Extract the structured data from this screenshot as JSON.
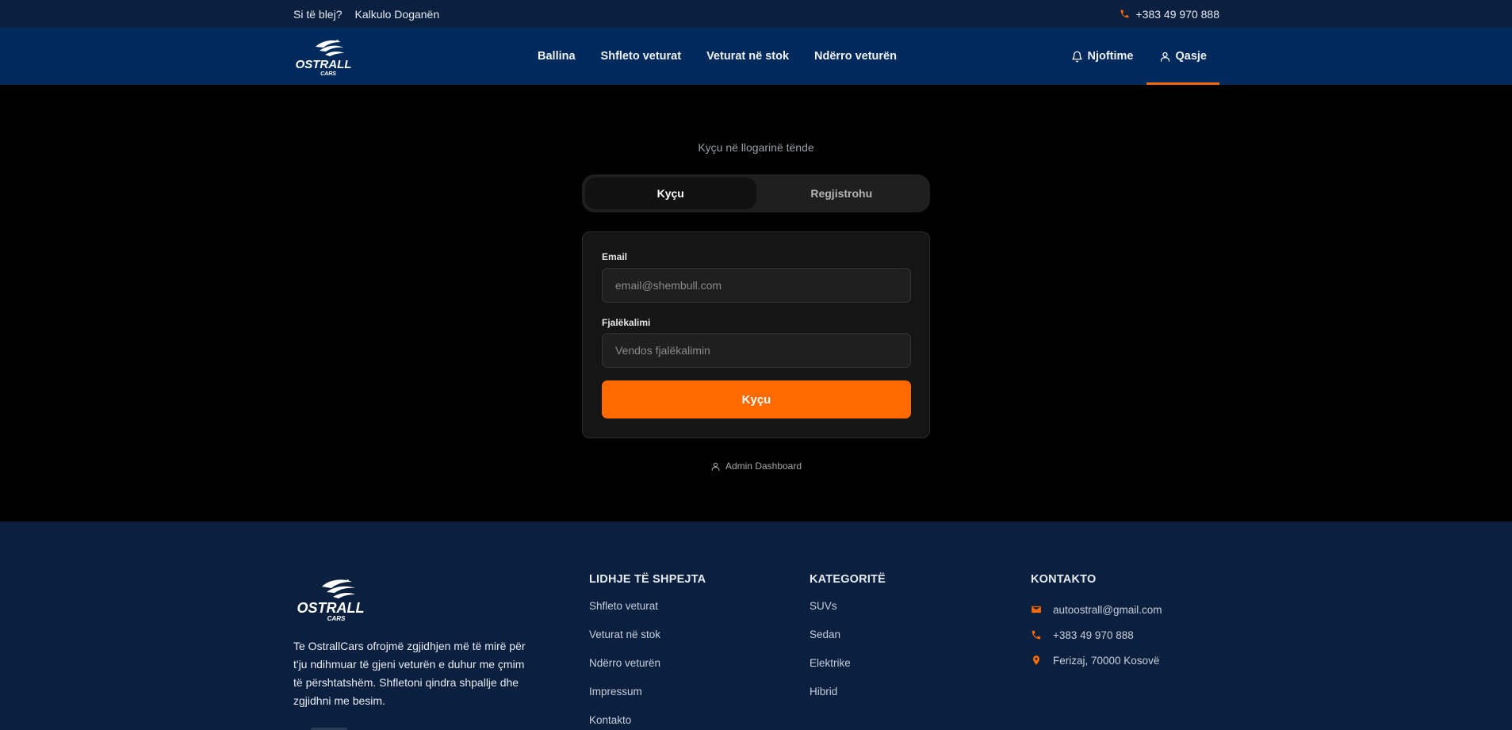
{
  "topbar": {
    "links": [
      "Si të blej?",
      "Kalkulo Doganën"
    ],
    "phone": "+383 49 970 888"
  },
  "brand": {
    "name": "OSTRALL",
    "sub": "CARS"
  },
  "nav": {
    "items": [
      "Ballina",
      "Shfleto veturat",
      "Veturat në stok",
      "Ndërro veturën"
    ],
    "notifications": "Njoftime",
    "access": "Qasje"
  },
  "auth": {
    "subtitle": "Kyçu në llogarinë tënde",
    "tabs": [
      "Kyçu",
      "Regjistrohu"
    ],
    "email_label": "Email",
    "email_placeholder": "email@shembull.com",
    "password_label": "Fjalëkalimi",
    "password_placeholder": "Vendos fjalëkalimin",
    "submit_label": "Kyçu",
    "admin_link": "Admin Dashboard"
  },
  "footer": {
    "about": "Te OstrallCars ofrojmë zgjidhjen më të mirë për t'ju ndihmuar të gjeni veturën e duhur me çmim të përshtatshëm. Shfletoni qindra shpallje dhe zgjidhni me besim.",
    "quick_links": {
      "title": "LIDHJE TË SHPEJTA",
      "items": [
        "Shfleto veturat",
        "Veturat në stok",
        "Ndërro veturën",
        "Impressum",
        "Kontakto"
      ]
    },
    "categories": {
      "title": "KATEGORITË",
      "items": [
        "SUVs",
        "Sedan",
        "Elektrike",
        "Hibrid"
      ]
    },
    "contact": {
      "title": "KONTAKTO",
      "email": "autoostrall@gmail.com",
      "phone": "+383 49 970 888",
      "address": "Ferizaj, 70000 Kosovë"
    }
  },
  "colors": {
    "accent": "#ff6a00",
    "nav_bg": "#00295c",
    "topbar_bg": "#0b1f3f"
  }
}
